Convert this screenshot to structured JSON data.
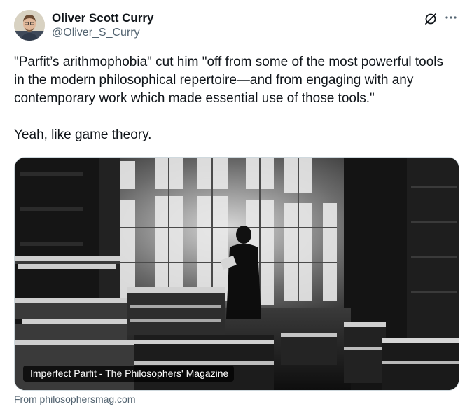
{
  "author": {
    "display_name": "Oliver Scott Curry",
    "handle": "@Oliver_S_Curry",
    "avatar_icon": "avatar-photo"
  },
  "actions": {
    "grok_icon": "grok-icon",
    "more_icon": "more-options-icon"
  },
  "tweet": {
    "paragraph_1": "\"Parfit’s arithmophobia\" cut him \"off from some of the most powerful tools in the modern philosophical repertoire—and from engaging with any contemporary work which made essential use of those tools.\"",
    "paragraph_2": "Yeah, like game theory."
  },
  "link_card": {
    "title": "Imperfect Parfit - The Philosophers' Magazine",
    "source": "From philosophersmag.com",
    "image_description_icon": "library-scene-image"
  },
  "colors": {
    "text_primary": "#0f1419",
    "text_secondary": "#536471",
    "border": "#cfd9de"
  }
}
